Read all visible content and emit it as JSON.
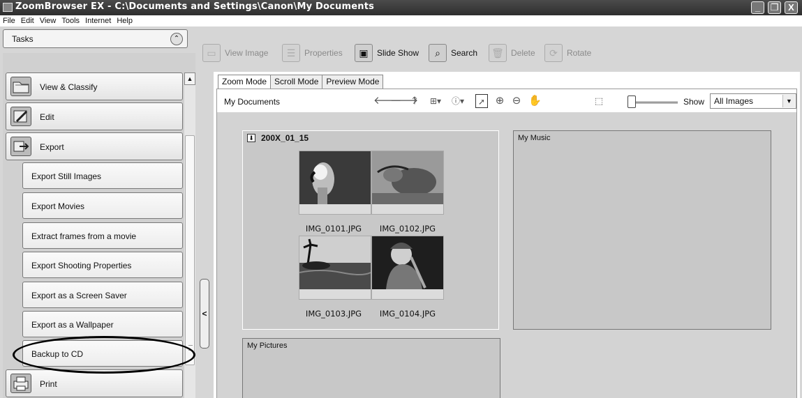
{
  "window": {
    "title": "ZoomBrowser EX  - C:\\Documents and Settings\\Canon\\My Documents",
    "minimize": "_",
    "restore": "❐",
    "close": "X"
  },
  "menu": [
    "File",
    "Edit",
    "View",
    "Tools",
    "Internet",
    "Help"
  ],
  "tasks": {
    "header": "Tasks",
    "collapse_glyph": "⌃",
    "items": [
      {
        "label": "View & Classify"
      },
      {
        "label": "Edit"
      },
      {
        "label": "Export"
      }
    ],
    "export_subitems": [
      "Export Still Images",
      "Export Movies",
      "Extract frames from a movie",
      "Export Shooting Properties",
      "Export as a Screen Saver",
      "Export as a Wallpaper",
      "Backup to CD"
    ],
    "print_label": "Print",
    "splitter_glyph": "<"
  },
  "toolbar": {
    "view_image": "View Image",
    "properties": "Properties",
    "slide_show": "Slide Show",
    "search": "Search",
    "delete": "Delete",
    "rotate": "Rotate"
  },
  "tabs": [
    "Zoom Mode",
    "Scroll Mode",
    "Preview Mode"
  ],
  "pathbar": {
    "path": "My Documents",
    "show_label": "Show",
    "show_value": "All Images",
    "icons": [
      "back-arrow",
      "forward-arrow",
      "up-folder",
      "select-menu",
      "info-menu",
      "pointer",
      "zoom-in",
      "zoom-out",
      "hand",
      "fit"
    ]
  },
  "folders": {
    "main": {
      "name": "200X_01_15",
      "images": [
        "IMG_0101.JPG",
        "IMG_0102.JPG",
        "IMG_0103.JPG",
        "IMG_0104.JPG"
      ]
    },
    "music": "My Music",
    "pictures": "My Pictures"
  }
}
